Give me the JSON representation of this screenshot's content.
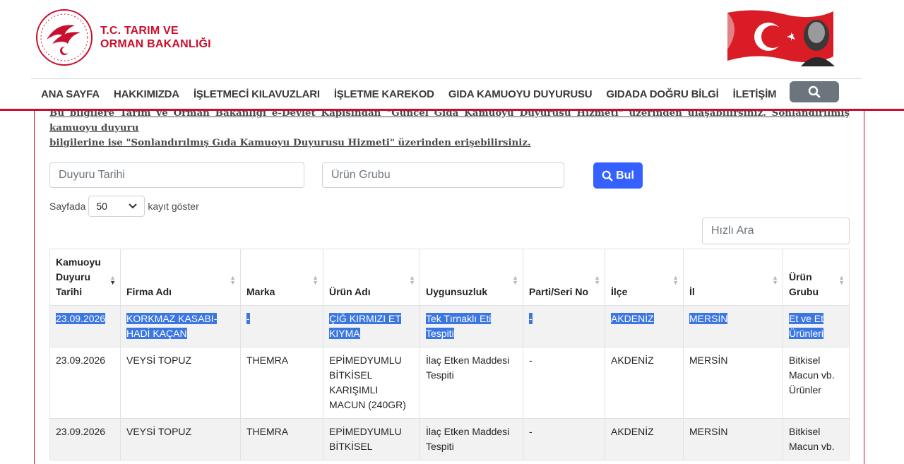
{
  "header": {
    "logo_line1": "T.C. TARIM VE",
    "logo_line2": "ORMAN BAKANLIĞI"
  },
  "nav": {
    "items": [
      "ANA SAYFA",
      "HAKKIMIZDA",
      "İŞLETMECİ KILAVUZLARI",
      "İŞLETME KAREKOD",
      "GIDA KAMUOYU DUYURUSU",
      "GIDADA DOĞRU BİLGİ",
      "İLETİŞİM"
    ],
    "search_icon": "search-icon"
  },
  "notice": {
    "line1": "Bu bilgilere Tarım ve Orman Bakanlığı e-Devlet Kapısından \"Güncel Gıda Kamuoyu Duyurusu Hizmeti\" üzerinden ulaşabilirsiniz. Sonlandırılmış kamuoyu duyuru",
    "line2": "bilgilerine ise \"Sonlandırılmış Gıda Kamuoyu Duyurusu Hizmeti\" üzerinden erişebilirsiniz."
  },
  "filters": {
    "date_placeholder": "Duyuru Tarihi",
    "group_placeholder": "Ürün Grubu",
    "find_label": "Bul"
  },
  "length": {
    "prefix": "Sayfada",
    "value": "50",
    "suffix": "kayıt göster"
  },
  "quick_search_placeholder": "Hızlı Ara",
  "table": {
    "headers": [
      "Kamuoyu Duyuru Tarihi",
      "Firma Adı",
      "Marka",
      "Ürün Adı",
      "Uygunsuzluk",
      "Parti/Seri No",
      "İlçe",
      "İl",
      "Ürün Grubu"
    ],
    "rows": [
      [
        "23.09.2026",
        "KORKMAZ KASABI-HADİ KAÇAN",
        "-",
        "ÇİĞ KIRMIZI ET KIYMA",
        "Tek Tırnaklı Eti Tespiti",
        "-",
        "AKDENİZ",
        "MERSİN",
        "Et ve Et Ürünleri"
      ],
      [
        "23.09.2026",
        "VEYSİ TOPUZ",
        "THEMRA",
        "EPİMEDYUMLU BİTKİSEL KARIŞIMLI MACUN (240GR)",
        "İlaç Etken Maddesi Tespiti",
        "-",
        "AKDENİZ",
        "MERSİN",
        "Bitkisel Macun vb. Ürünler"
      ],
      [
        "23.09.2026",
        "VEYSİ TOPUZ",
        "THEMRA",
        "EPİMEDYUMLU BİTKİSEL",
        "İlaç Etken Maddesi Tespiti",
        "-",
        "AKDENİZ",
        "MERSİN",
        "Bitkisel Macun vb."
      ]
    ]
  },
  "colors": {
    "brand_red": "#c8102e",
    "button_blue": "#3461ff",
    "selection_blue": "#3b76e1"
  }
}
